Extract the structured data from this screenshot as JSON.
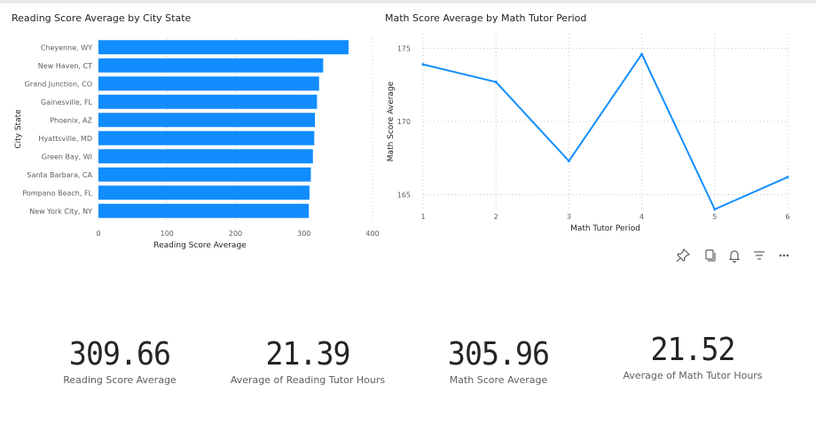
{
  "colors": {
    "accent": "#118dff",
    "axis_text": "#605e5c",
    "gridline": "#c8c6c4"
  },
  "chart_data": [
    {
      "type": "bar",
      "orientation": "horizontal",
      "title": "Reading Score Average by City State",
      "xlabel": "Reading Score Average",
      "ylabel": "City State",
      "categories": [
        "Cheyenne, WY",
        "New Haven, CT",
        "Grand Junction, CO",
        "Gainesville, FL",
        "Phoenix, AZ",
        "Hyattsville, MD",
        "Green Bay, WI",
        "Santa Barbara, CA",
        "Pompano Beach, FL",
        "New York City, NY"
      ],
      "values": [
        365,
        328,
        322,
        319,
        316,
        315,
        313,
        310,
        308,
        307
      ],
      "xlim": [
        0,
        400
      ],
      "xticks": [
        0,
        100,
        200,
        300,
        400
      ],
      "grid": true
    },
    {
      "type": "line",
      "title": "Math Score Average by Math Tutor Period",
      "xlabel": "Math Tutor Period",
      "ylabel": "Math Score Average",
      "x": [
        1,
        2,
        3,
        4,
        5,
        6
      ],
      "values": [
        173.9,
        172.7,
        167.3,
        174.6,
        164.0,
        166.2
      ],
      "ylim": [
        164,
        176
      ],
      "yticks": [
        165,
        170,
        175
      ],
      "grid": true
    }
  ],
  "cards": [
    {
      "value": "309.66",
      "label": "Reading Score Average"
    },
    {
      "value": "21.39",
      "label": "Average of Reading Tutor Hours"
    },
    {
      "value": "305.96",
      "label": "Math Score Average"
    },
    {
      "value": "21.52",
      "label": "Average of Math Tutor Hours"
    }
  ],
  "toolbar": [
    "pin-icon",
    "copy-icon",
    "bell-icon",
    "filter-icon",
    "more-icon"
  ]
}
